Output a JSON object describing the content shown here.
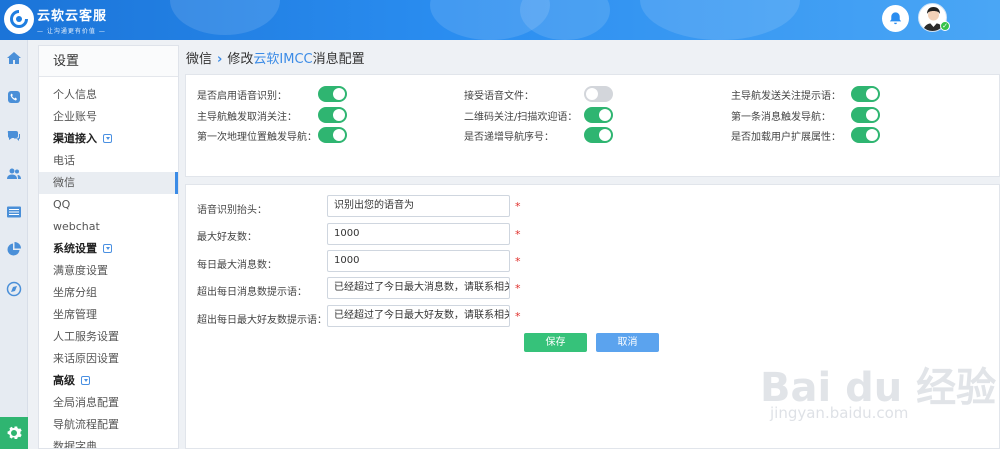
{
  "brand": {
    "name": "云软云客服",
    "slogan": "— 让沟通更有价值 —"
  },
  "menu": {
    "title": "设置",
    "items": [
      {
        "label": "个人信息",
        "type": "item"
      },
      {
        "label": "企业账号",
        "type": "item"
      },
      {
        "label": "渠道接入",
        "type": "section"
      },
      {
        "label": "电话",
        "type": "item"
      },
      {
        "label": "微信",
        "type": "item",
        "active": true
      },
      {
        "label": "QQ",
        "type": "item"
      },
      {
        "label": "webchat",
        "type": "item"
      },
      {
        "label": "系统设置",
        "type": "section"
      },
      {
        "label": "满意度设置",
        "type": "item"
      },
      {
        "label": "坐席分组",
        "type": "item"
      },
      {
        "label": "坐席管理",
        "type": "item"
      },
      {
        "label": "人工服务设置",
        "type": "item"
      },
      {
        "label": "来话原因设置",
        "type": "item"
      },
      {
        "label": "高级",
        "type": "section"
      },
      {
        "label": "全局消息配置",
        "type": "item"
      },
      {
        "label": "导航流程配置",
        "type": "item"
      },
      {
        "label": "数据字典",
        "type": "item"
      }
    ]
  },
  "breadcrumb": {
    "parent": "微信",
    "sep": "›",
    "prefix": "修改",
    "highlight": "云软IMCC",
    "suffix": "消息配置"
  },
  "toggles": [
    {
      "label": "是否启用语音识别：",
      "on": true
    },
    {
      "label": "接受语音文件：",
      "on": false
    },
    {
      "label": "主导航发送关注提示语：",
      "on": true
    },
    {
      "label": "主导航触发取消关注：",
      "on": true
    },
    {
      "label": "二维码关注/扫描欢迎语：",
      "on": true
    },
    {
      "label": "第一条消息触发导航：",
      "on": true
    },
    {
      "label": "第一次地理位置触发导航：",
      "on": true
    },
    {
      "label": "是否递增导航序号：",
      "on": true
    },
    {
      "label": "是否加载用户扩展属性：",
      "on": true
    }
  ],
  "form": {
    "fields": [
      {
        "label": "语音识别抬头：",
        "value": "识别出您的语音为"
      },
      {
        "label": "最大好友数：",
        "value": "1000"
      },
      {
        "label": "每日最大消息数：",
        "value": "1000"
      },
      {
        "label": "超出每日消息数提示语：",
        "value": "已经超过了今日最大消息数，请联系相关"
      },
      {
        "label": "超出每日最大好友数提示语：",
        "value": "已经超过了今日最大好友数，请联系相关"
      }
    ],
    "required_mark": "*",
    "save_label": "保存",
    "cancel_label": "取消"
  },
  "watermark": {
    "main": "Bai du 经验",
    "sub": "jingyan.baidu.com"
  },
  "colors": {
    "header": "#2a8df0",
    "toggle_on": "#2fb571",
    "toggle_off": "#d3d6db",
    "save": "#36c27a",
    "cancel": "#5ba3ee",
    "accent": "#3b8be6"
  }
}
